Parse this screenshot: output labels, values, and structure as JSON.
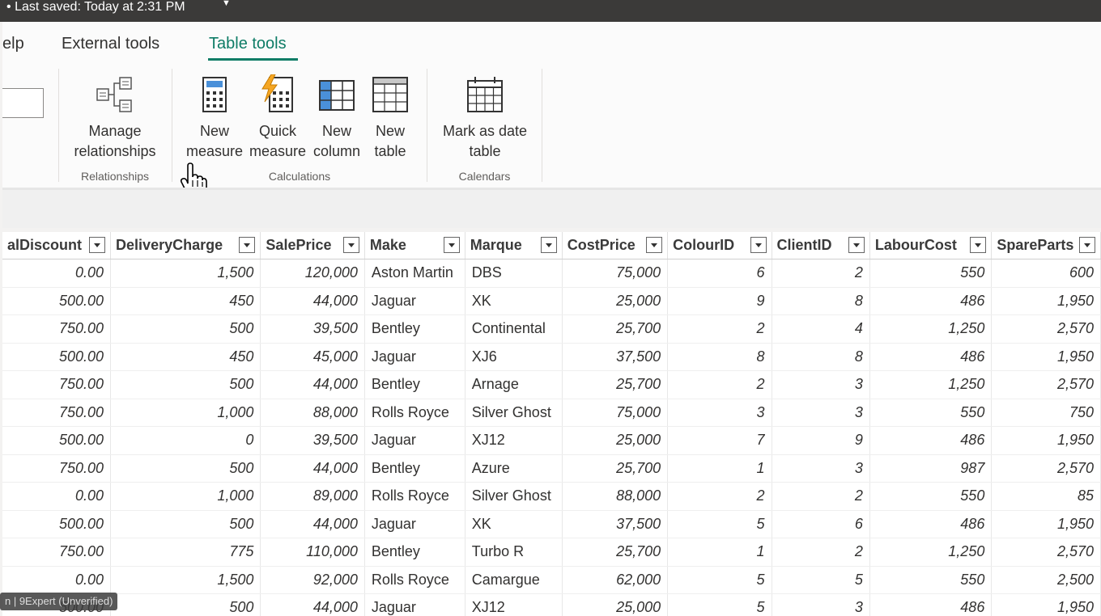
{
  "titlebar": {
    "text": "Last saved: Today at 2:31 PM"
  },
  "tabs": [
    {
      "label": "elp"
    },
    {
      "label": "External tools"
    },
    {
      "label": "Table tools"
    }
  ],
  "ribbon": {
    "relationships": {
      "group": "Relationships",
      "manage_line1": "Manage",
      "manage_line2": "relationships"
    },
    "calculations": {
      "group": "Calculations",
      "new_measure_line1": "New",
      "new_measure_line2": "measure",
      "quick_measure_line1": "Quick",
      "quick_measure_line2": "measure",
      "new_column_line1": "New",
      "new_column_line2": "column",
      "new_table_line1": "New",
      "new_table_line2": "table"
    },
    "calendars": {
      "group": "Calendars",
      "mark_line1": "Mark as date",
      "mark_line2": "table"
    }
  },
  "grid": {
    "columns": [
      "alDiscount",
      "DeliveryCharge",
      "SalePrice",
      "Make",
      "Marque",
      "CostPrice",
      "ColourID",
      "ClientID",
      "LabourCost",
      "SpareParts"
    ],
    "rows": [
      [
        "0.00",
        "1,500",
        "120,000",
        "Aston Martin",
        "DBS",
        "75,000",
        "6",
        "2",
        "550",
        "600"
      ],
      [
        "500.00",
        "450",
        "44,000",
        "Jaguar",
        "XK",
        "25,000",
        "9",
        "8",
        "486",
        "1,950"
      ],
      [
        "750.00",
        "500",
        "39,500",
        "Bentley",
        "Continental",
        "25,700",
        "2",
        "4",
        "1,250",
        "2,570"
      ],
      [
        "500.00",
        "450",
        "45,000",
        "Jaguar",
        "XJ6",
        "37,500",
        "8",
        "8",
        "486",
        "1,950"
      ],
      [
        "750.00",
        "500",
        "44,000",
        "Bentley",
        "Arnage",
        "25,700",
        "2",
        "3",
        "1,250",
        "2,570"
      ],
      [
        "750.00",
        "1,000",
        "88,000",
        "Rolls Royce",
        "Silver Ghost",
        "75,000",
        "3",
        "3",
        "550",
        "750"
      ],
      [
        "500.00",
        "0",
        "39,500",
        "Jaguar",
        "XJ12",
        "25,000",
        "7",
        "9",
        "486",
        "1,950"
      ],
      [
        "750.00",
        "500",
        "44,000",
        "Bentley",
        "Azure",
        "25,700",
        "1",
        "3",
        "987",
        "2,570"
      ],
      [
        "0.00",
        "1,000",
        "89,000",
        "Rolls Royce",
        "Silver Ghost",
        "88,000",
        "2",
        "2",
        "550",
        "85"
      ],
      [
        "500.00",
        "500",
        "44,000",
        "Jaguar",
        "XK",
        "37,500",
        "5",
        "6",
        "486",
        "1,950"
      ],
      [
        "750.00",
        "775",
        "110,000",
        "Bentley",
        "Turbo R",
        "25,700",
        "1",
        "2",
        "1,250",
        "2,570"
      ],
      [
        "0.00",
        "1,500",
        "92,000",
        "Rolls Royce",
        "Camargue",
        "62,000",
        "5",
        "5",
        "550",
        "2,500"
      ],
      [
        "500.00",
        "500",
        "44,000",
        "Jaguar",
        "XJ12",
        "25,000",
        "5",
        "3",
        "486",
        "1,950"
      ]
    ]
  },
  "watermark": {
    "text": "n | 9Expert (Unverified)"
  }
}
